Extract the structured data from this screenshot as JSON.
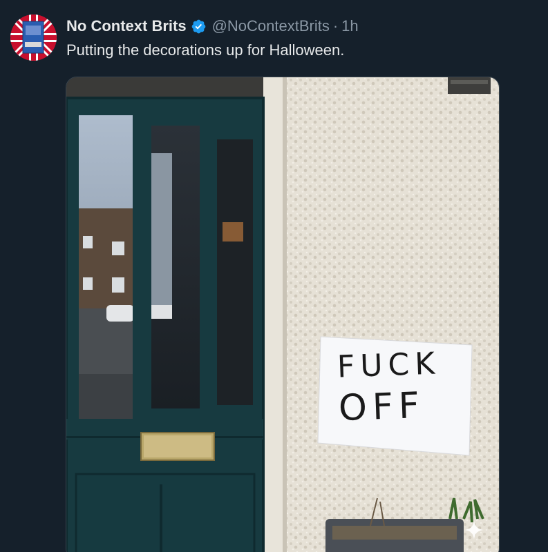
{
  "tweet": {
    "display_name": "No Context Brits",
    "handle": "@NoContextBrits",
    "separator": "·",
    "time": "1h",
    "text": "Putting the decorations up for Halloween.",
    "verified_icon": "verified-badge-icon",
    "avatar": "profile-avatar"
  },
  "media": {
    "sign_line1": "FUCK",
    "sign_line2": "OFF",
    "sparkle_icon": "sparkle-icon"
  },
  "colors": {
    "background": "#15202b",
    "primary_text": "#e7e9ea",
    "secondary_text": "#8b98a5",
    "verified_blue": "#1d9bf0"
  }
}
